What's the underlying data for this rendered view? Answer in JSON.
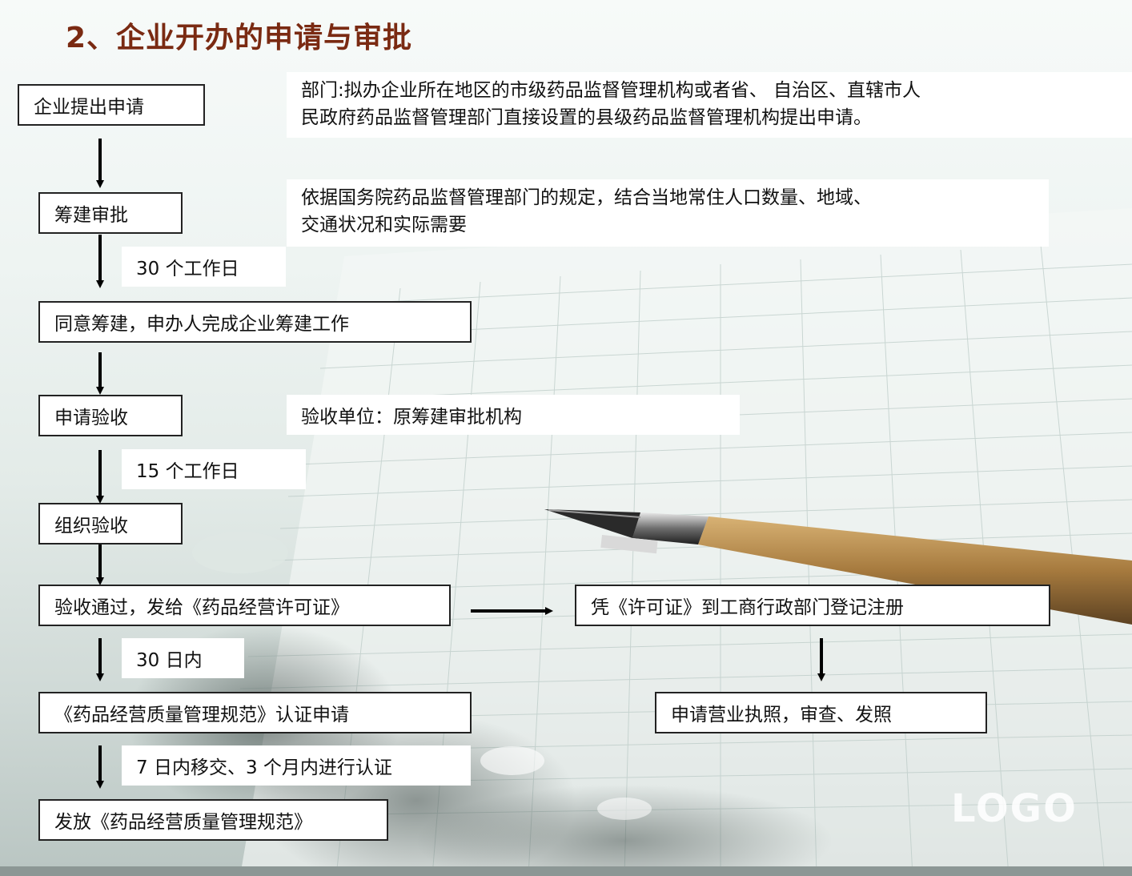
{
  "title": "2、企业开办的申请与审批",
  "steps": {
    "apply": "企业提出申请",
    "approval": "筹建审批",
    "prepare": "同意筹建，申办人完成企业筹建工作",
    "inspect_apply": "申请验收",
    "inspect": "组织验收",
    "pass": "验收通过，发给《药品经营许可证》",
    "gsp_apply": "《药品经营质量管理规范》认证申请",
    "gsp_issue": "发放《药品经营质量管理规范》",
    "register": "凭《许可证》到工商行政部门登记注册",
    "license": "申请营业执照，审查、发照"
  },
  "notes": {
    "department_line1": "部门:拟办企业所在地区的市级药品监督管理机构或者省、 自治区、直辖市人",
    "department_line2": "民政府药品监督管理部门直接设置的县级药品监督管理机构提出申请。",
    "basis_line1": "依据国务院药品监督管理部门的规定，结合当地常住人口数量、地域、",
    "basis_line2": "交通状况和实际需要",
    "inspection_unit": "验收单位：原筹建审批机构"
  },
  "durations": {
    "d1": "30 个工作日",
    "d2": "15 个工作日",
    "d3": "30 日内",
    "d4": "7 日内移交、3 个月内进行认证"
  },
  "logo": "LOGO",
  "colors": {
    "title": "#7a2a12",
    "border": "#222222",
    "arrow": "#000000"
  }
}
